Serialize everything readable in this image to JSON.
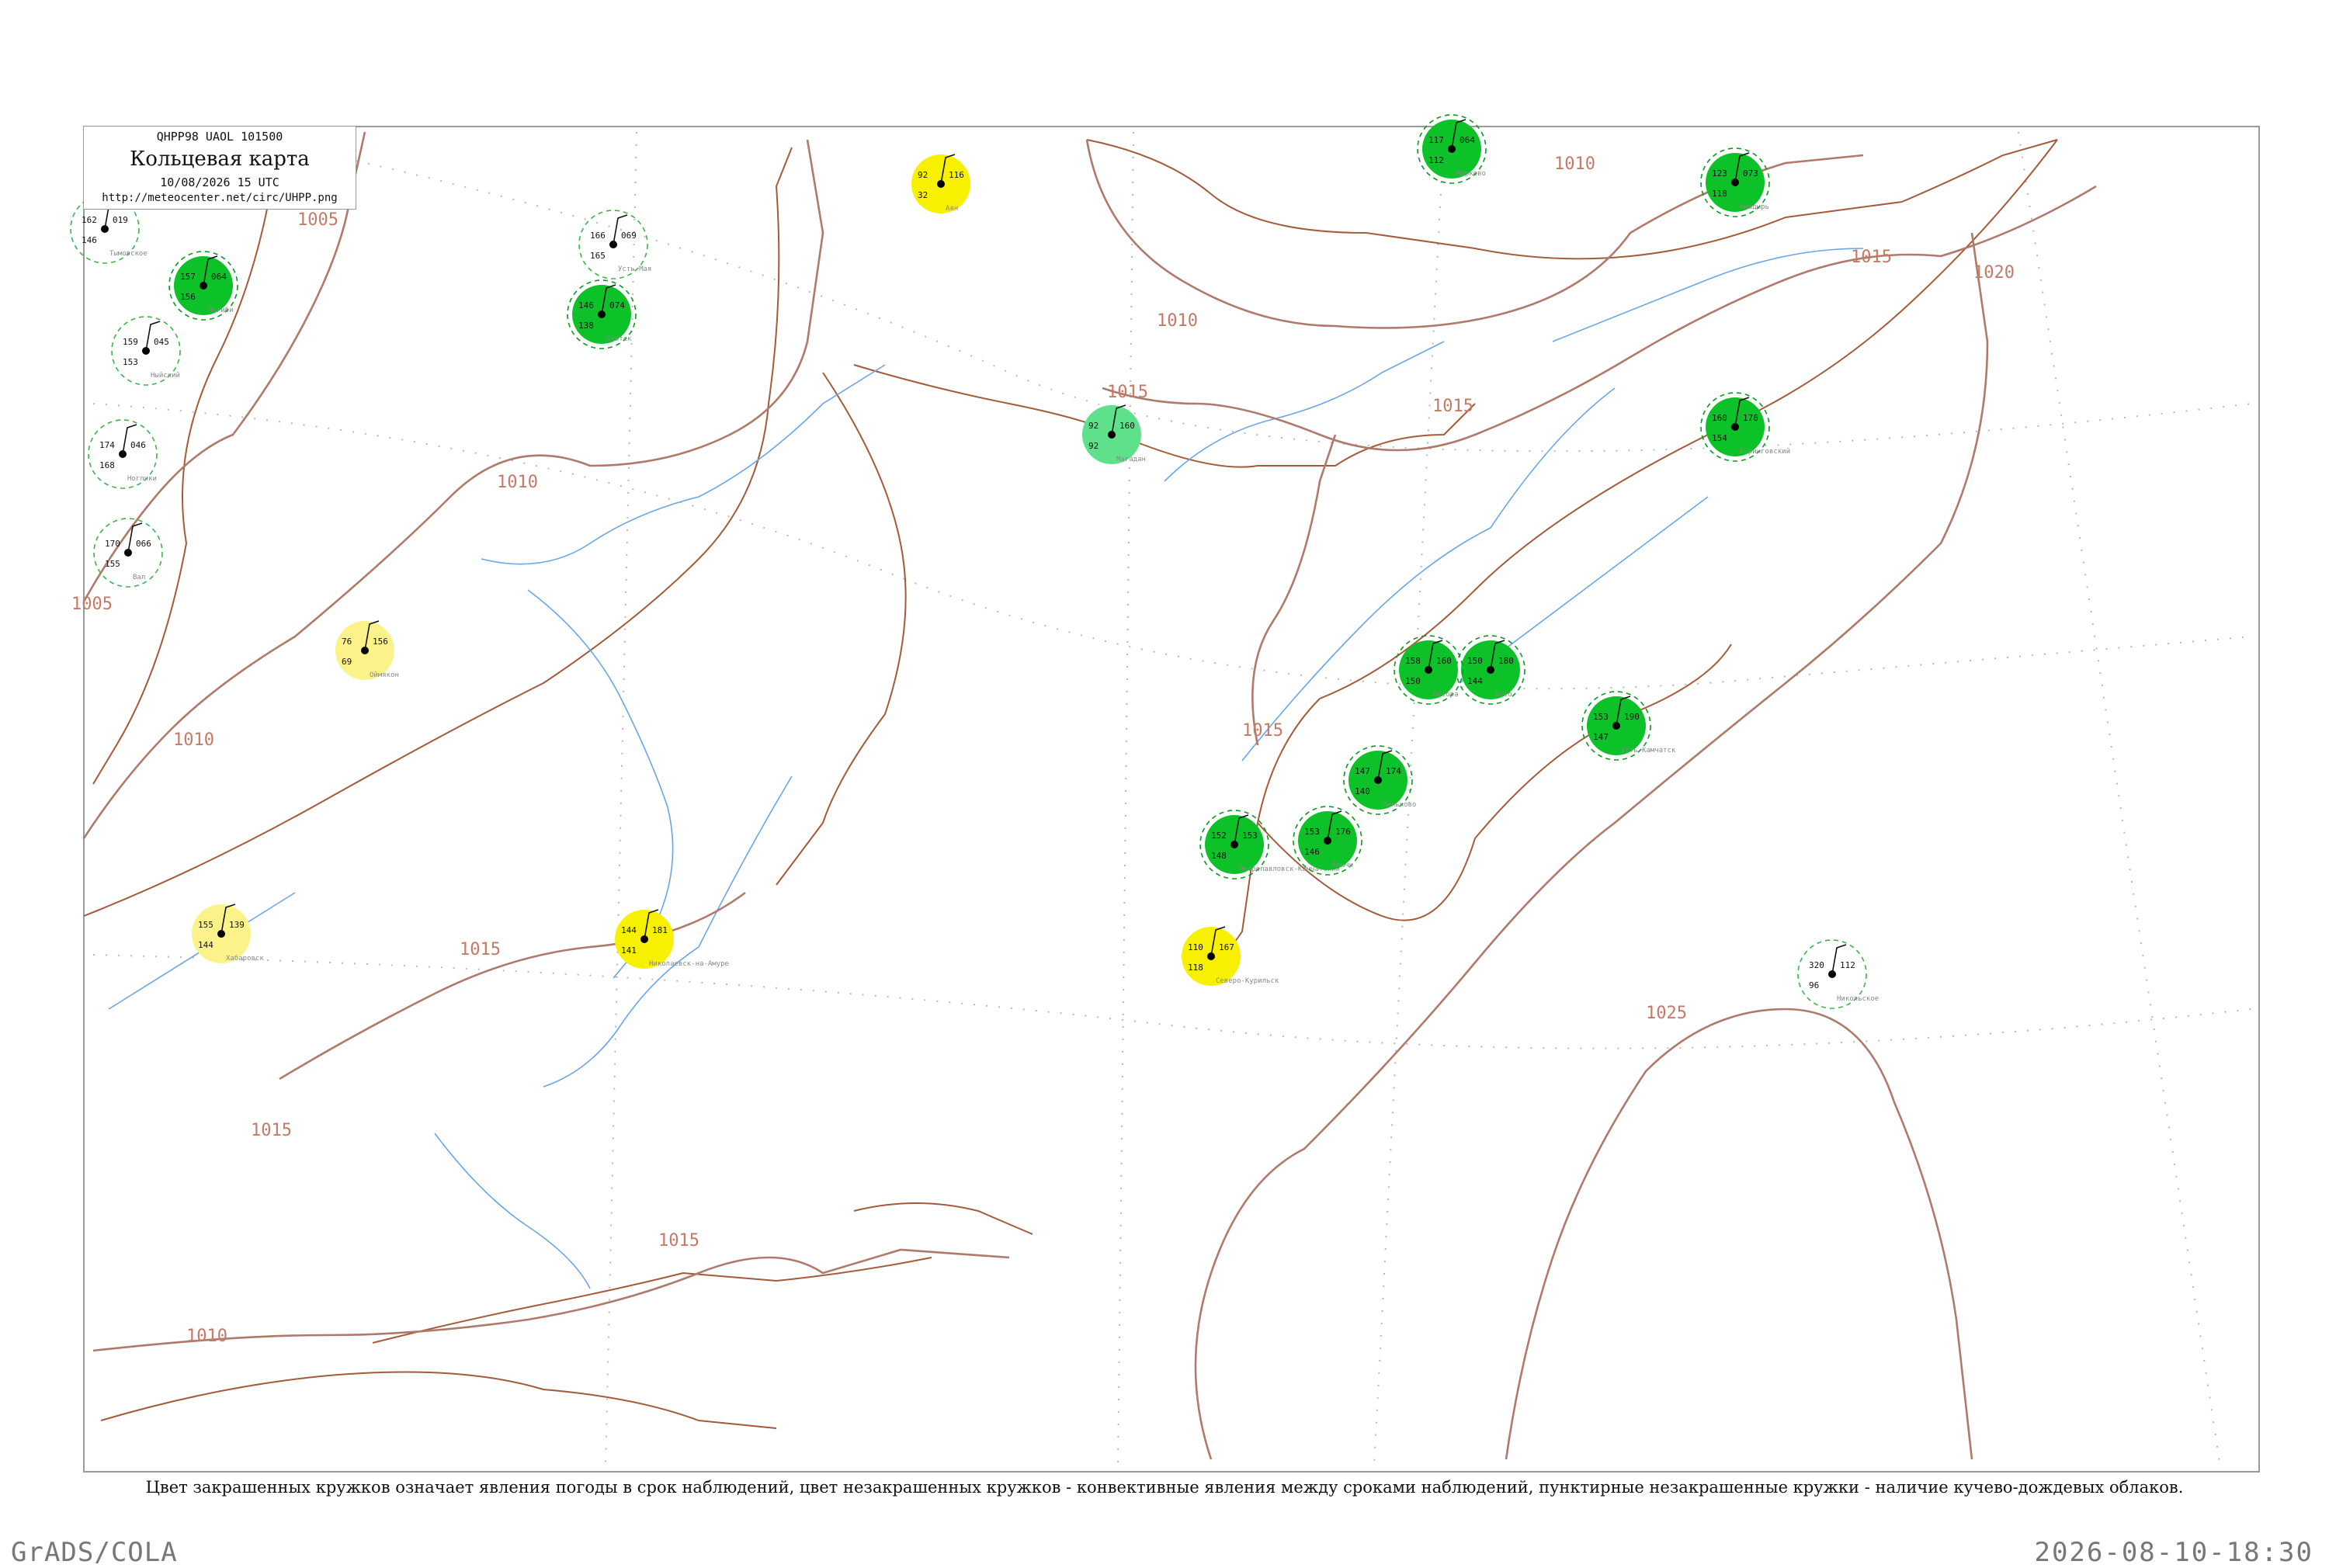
{
  "header": {
    "code": "QHPP98  UAOL  101500",
    "title": "Кольцевая карта",
    "date": "10/08/2026 15 UTC",
    "url": "http://meteocenter.net/circ/UHPP.png"
  },
  "caption": "Цвет закрашенных кружков означает явления погоды в срок наблюдений, цвет незакрашенных кружков - конвективные явления между сроками наблюдений, пунктирные незакрашенные кружки - наличие кучево-дождевых облаков.",
  "footer": {
    "left": "GrADS/COLA",
    "right": "2026-08-10-18:30"
  },
  "colors": {
    "isobar": "#b07a6a",
    "coast": "#a55a3a",
    "river": "#6aa6e6",
    "green_weather": "#0cc228",
    "yellow_weather": "#f7f000",
    "cb_ring": "#3bb54a"
  },
  "isobar_labels": [
    {
      "value": "1005"
    },
    {
      "value": "1005"
    },
    {
      "value": "1010"
    },
    {
      "value": "1010"
    },
    {
      "value": "1010"
    },
    {
      "value": "1010"
    },
    {
      "value": "1010"
    },
    {
      "value": "1015"
    },
    {
      "value": "1015"
    },
    {
      "value": "1015"
    },
    {
      "value": "1015"
    },
    {
      "value": "1015"
    },
    {
      "value": "1015"
    },
    {
      "value": "1015"
    },
    {
      "value": "1020"
    },
    {
      "value": "1025"
    }
  ],
  "stations": [
    {
      "name": "Тымовское",
      "t": "162",
      "p": "019",
      "td": "146",
      "circle": "ring"
    },
    {
      "name": "Погиби",
      "t": "157",
      "p": "064",
      "td": "156",
      "circle": "green"
    },
    {
      "name": "Ныйский",
      "t": "159",
      "p": "045",
      "td": "153",
      "circle": "ring"
    },
    {
      "name": "Ноглики",
      "t": "174",
      "p": "046",
      "td": "168",
      "circle": "ring"
    },
    {
      "name": "Вал",
      "t": "170",
      "p": "066",
      "td": "155",
      "circle": "ring"
    },
    {
      "name": "Охотск",
      "t": "146",
      "p": "074",
      "td": "138",
      "circle": "green"
    },
    {
      "name": "Усть-Мая",
      "t": "166",
      "p": "069",
      "td": "165",
      "circle": "ring"
    },
    {
      "name": "Аян",
      "t": "92",
      "p": "116",
      "td": "32",
      "circle": "yellow"
    },
    {
      "name": "Магадан",
      "t": "92",
      "p": "160",
      "td": "92",
      "circle": "lgreen"
    },
    {
      "name": "Северо-Курильск",
      "t": "110",
      "p": "167",
      "td": "118",
      "circle": "yellow"
    },
    {
      "name": "Николаевск-на-Амуре",
      "t": "144",
      "p": "181",
      "td": "141",
      "circle": "yellow"
    },
    {
      "name": "Оймякон",
      "t": "76",
      "p": "156",
      "td": "69",
      "circle": "lyellow"
    },
    {
      "name": "Хабаровск",
      "t": "155",
      "p": "139",
      "td": "144",
      "circle": "lyellow"
    },
    {
      "name": "Петропавловск-Камчатский",
      "t": "152",
      "p": "153",
      "td": "148",
      "circle": "green"
    },
    {
      "name": "Ключи",
      "t": "153",
      "p": "176",
      "td": "146",
      "circle": "green"
    },
    {
      "name": "Усть-Камчатск",
      "t": "153",
      "p": "190",
      "td": "147",
      "circle": "green"
    },
    {
      "name": "Мильково",
      "t": "147",
      "p": "174",
      "td": "140",
      "circle": "green"
    },
    {
      "name": "Эссо",
      "t": "150",
      "p": "180",
      "td": "144",
      "circle": "green"
    },
    {
      "name": "Оссора",
      "t": "158",
      "p": "160",
      "td": "150",
      "circle": "green"
    },
    {
      "name": "Марково",
      "t": "117",
      "p": "064",
      "td": "112",
      "circle": "green"
    },
    {
      "name": "Анадырь",
      "t": "123",
      "p": "073",
      "td": "118",
      "circle": "green"
    },
    {
      "name": "Беринговский",
      "t": "160",
      "p": "176",
      "td": "154",
      "circle": "green"
    },
    {
      "name": "Никольское",
      "t": "320",
      "p": "112",
      "td": "96",
      "circle": "ring"
    }
  ]
}
